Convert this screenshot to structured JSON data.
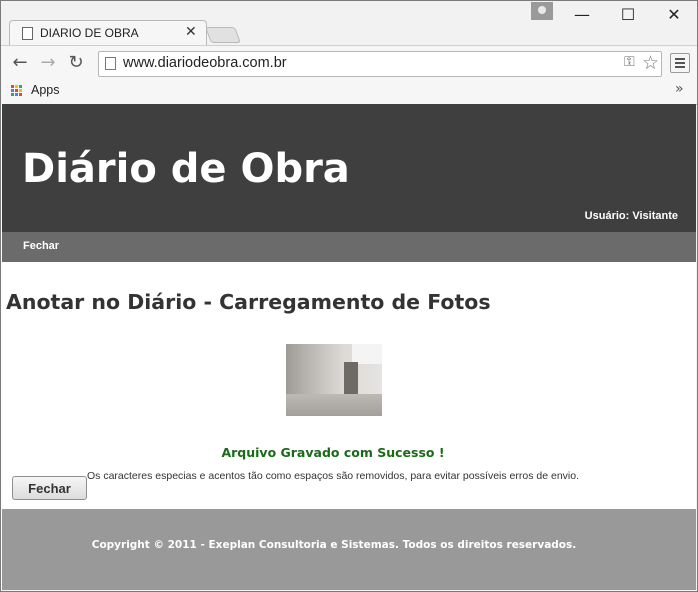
{
  "browser": {
    "tab_title": "DIARIO DE OBRA",
    "url": "www.diariodeobra.com.br",
    "bookmarks": {
      "apps_label": "Apps"
    },
    "window_controls": {
      "minimize": "—",
      "maximize": "☐",
      "close": "✕"
    }
  },
  "site": {
    "title": "Diário de Obra",
    "user_label": "Usuário: Visitante",
    "nav": {
      "close_label": "Fechar"
    }
  },
  "main": {
    "heading": "Anotar no Diário - Carregamento de Fotos",
    "success_message": "Arquivo Gravado com Sucesso !",
    "note": "Os caracteres especias e acentos tão como espaços são removidos, para evitar possíveis erros de envio.",
    "close_button": "Fechar"
  },
  "footer": {
    "copyright": "Copyright © 2011 - Exeplan Consultoria e Sistemas. Todos os direitos reservados."
  },
  "colors": {
    "header_bg": "#3f3f3f",
    "nav_bg": "#6b6b6b",
    "footer_bg": "#999999",
    "success_text": "#1a6a1a"
  },
  "icons": [
    "page-icon",
    "close-icon",
    "back-arrow-icon",
    "forward-arrow-icon",
    "reload-icon",
    "key-icon",
    "star-icon",
    "menu-icon",
    "apps-grid-icon",
    "chevron-right-icon",
    "profile-icon"
  ]
}
